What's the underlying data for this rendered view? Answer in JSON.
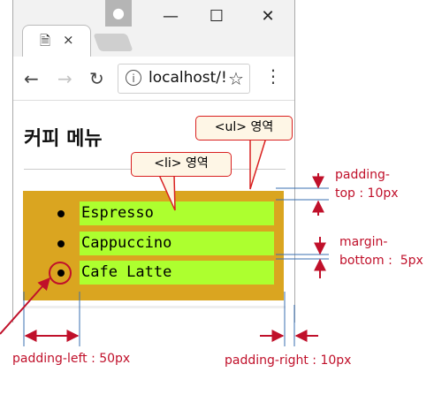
{
  "browser": {
    "url": "localhost/!",
    "window_buttons": {
      "minimize": "—",
      "maximize": "☐",
      "close": "✕"
    },
    "tab_close": "×"
  },
  "page": {
    "title": "커피 메뉴",
    "list_items": [
      "Espresso",
      "Cappuccino",
      "Cafe Latte"
    ]
  },
  "annotations": {
    "ul_callout": "<ul> 영역",
    "li_callout": "<li> 영역",
    "padding_top": [
      "padding-",
      "top : 10px"
    ],
    "margin_bottom": [
      "margin-",
      "bottom :  5px"
    ],
    "padding_left": "padding-left : 50px",
    "padding_right": "padding-right : 10px"
  },
  "colors": {
    "ul_background": "#daa520",
    "li_background": "#adff2f",
    "annotation": "#c0102a"
  },
  "icons": [
    "user-icon",
    "document-icon",
    "back-arrow-icon",
    "forward-arrow-icon",
    "reload-icon",
    "info-icon",
    "star-icon",
    "menu-dots-icon"
  ]
}
